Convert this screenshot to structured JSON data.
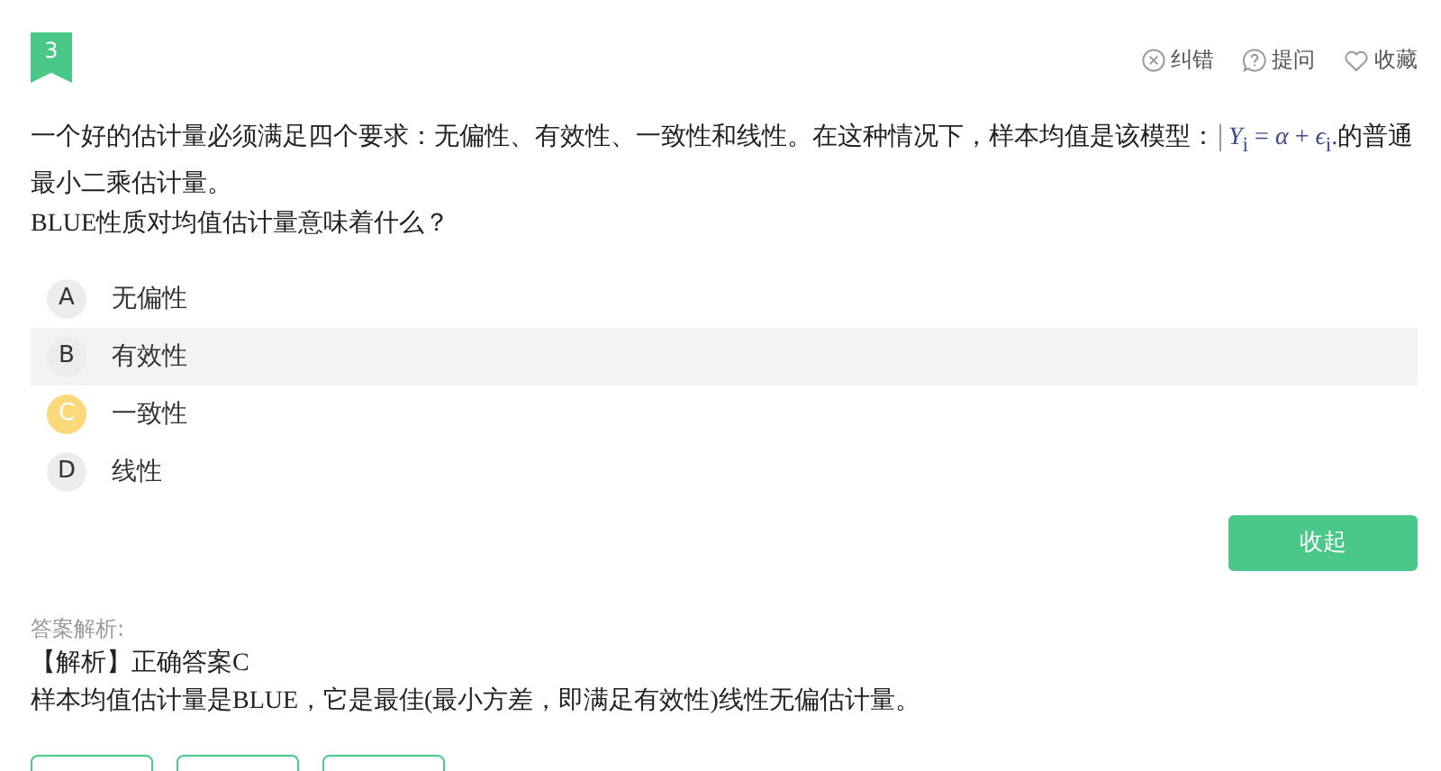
{
  "question_number": "3",
  "actions": [
    {
      "kind": "error",
      "label": "纠错"
    },
    {
      "kind": "ask",
      "label": "提问"
    },
    {
      "kind": "favorite",
      "label": "收藏"
    }
  ],
  "question": {
    "before": "一个好的估计量必须满足四个要求：无偏性、有效性、一致性和线性。在这种情况下，样本均值是该模型：",
    "formula": "*Y*$_{i}$ = *α* + *ϵ*$_{i}$.",
    "after": "的普通最小二乘估计量。",
    "line2": "BLUE性质对均值估计量意味着什么？"
  },
  "options": [
    {
      "letter": "A",
      "text": "无偏性",
      "selected": false,
      "hovered": false
    },
    {
      "letter": "B",
      "text": "有效性",
      "selected": false,
      "hovered": true
    },
    {
      "letter": "C",
      "text": "一致性",
      "selected": true,
      "hovered": false
    },
    {
      "letter": "D",
      "text": "线性",
      "selected": false,
      "hovered": false
    }
  ],
  "collapse_button": "收起",
  "analysis": {
    "label": "答案解析:",
    "lines": [
      "【解析】正确答案C",
      "样本均值估计量是BLUE，它是最佳(最小方差，即满足有效性)线性无偏估计量。"
    ]
  },
  "footer_buttons": [
    {
      "kind": "outline"
    },
    {
      "kind": "outline"
    },
    {
      "kind": "outline"
    }
  ]
}
